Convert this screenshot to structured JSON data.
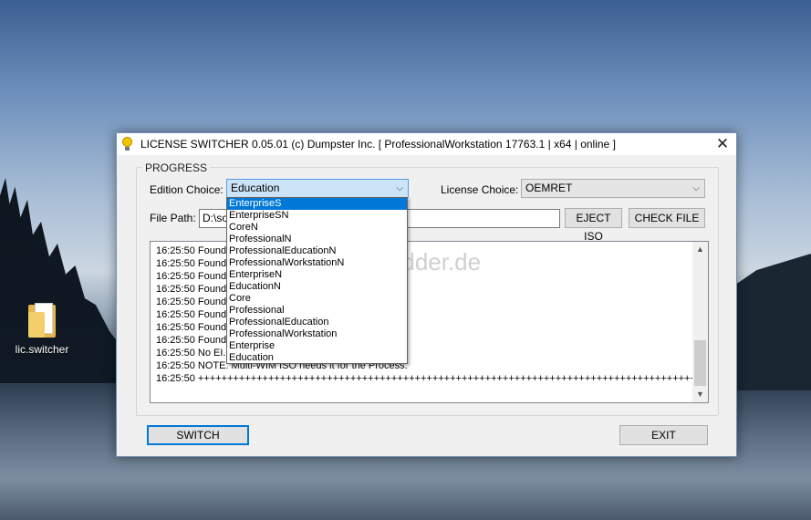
{
  "desktop": {
    "icon_label": "lic.switcher"
  },
  "window": {
    "title": "LICENSE SWITCHER 0.05.01 (c) Dumpster Inc. [ ProfessionalWorkstation 17763.1 | x64 | online ]",
    "close_glyph": "✕",
    "group_label": "PROGRESS",
    "edition": {
      "label": "Edition Choice:",
      "value": "Education",
      "options": [
        "EnterpriseS",
        "EnterpriseSN",
        "CoreN",
        "ProfessionalN",
        "ProfessionalEducationN",
        "ProfessionalWorkstationN",
        "EnterpriseN",
        "EducationN",
        "Core",
        "Professional",
        "ProfessionalEducation",
        "ProfessionalWorkstation",
        "Enterprise",
        "Education"
      ],
      "highlighted_option": "EnterpriseS"
    },
    "license": {
      "label": "License Choice:",
      "value": "OEMRET"
    },
    "file_path": {
      "label": "File Path:",
      "value": "D:\\so"
    },
    "eject_iso_label": "EJECT ISO",
    "check_file_label": "CHECK FILE",
    "log_lines": [
      "16:25:50 Found:",
      "16:25:50 Found:",
      "16:25:50 Found:",
      "16:25:50 Found:",
      "16:25:50 Found:",
      "16:25:50 Found:",
      "16:25:50 Found:",
      "16:25:50 Found:",
      "16:25:50 No EI.C",
      "16:25:50 NOTE: Multi-WIM ISO needs it for the Process.",
      "16:25:50 +++++++++++++++++++++++++++++++++++++++++++++++++++++++++++++++++++++++++++++++++++++"
    ],
    "switch_label": "SWITCH",
    "exit_label": "EXIT"
  },
  "watermark": "Deskmodder.de",
  "colors": {
    "accent": "#0078d7",
    "selected_option_bg": "#0078d7",
    "window_bg": "#f0f0f0"
  },
  "icons": [
    "app-lightbulb-icon",
    "close-icon",
    "chevron-down-icon",
    "scroll-up-icon",
    "scroll-down-icon",
    "folder-icon"
  ]
}
